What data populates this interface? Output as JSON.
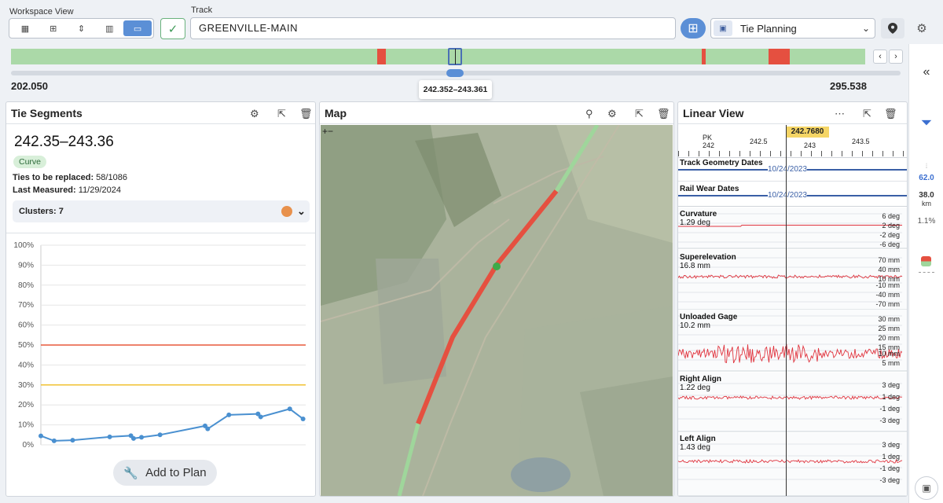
{
  "header": {
    "workspace_label": "Workspace View",
    "track_label": "Track",
    "track_value": "GREENVILLE-MAIN",
    "plan_value": "Tie Planning",
    "view_buttons": [
      {
        "icon": "table-icon",
        "active": false
      },
      {
        "icon": "grid-icon",
        "active": false
      },
      {
        "icon": "sort-icon",
        "active": false
      },
      {
        "icon": "map-icon",
        "active": false
      },
      {
        "icon": "window-icon",
        "active": true
      }
    ]
  },
  "range": {
    "start": "202.050",
    "end": "295.538",
    "tooltip": "242.352–243.361",
    "selected_fraction": [
      0.4283,
      0.4391
    ],
    "red_segments": [
      [
        0.4283,
        0.4391
      ],
      [
        0.8091,
        0.8135
      ],
      [
        0.8866,
        0.9114
      ]
    ]
  },
  "tie_segments": {
    "title": "Tie Segments",
    "range_title": "242.35–243.36",
    "chip": "Curve",
    "ties_label": "Ties to be replaced:",
    "ties_value": "58/1086",
    "measured_label": "Last Measured:",
    "measured_value": "11/29/2024",
    "clusters_label": "Clusters: 7",
    "cluster_color": "#e8914c",
    "add_button": "Add to Plan"
  },
  "chart_data": {
    "type": "line",
    "ylim": [
      0,
      100
    ],
    "yticks": [
      "100%",
      "90%",
      "80%",
      "70%",
      "60%",
      "50%",
      "40%",
      "30%",
      "20%",
      "10%",
      "0%"
    ],
    "thresholds": [
      {
        "value": 50,
        "color": "#e8593b"
      },
      {
        "value": 30,
        "color": "#f1c232"
      }
    ],
    "series": [
      {
        "values": [
          [
            0,
            4.5
          ],
          [
            0.05,
            2
          ],
          [
            0.12,
            2.3
          ],
          [
            0.26,
            4
          ],
          [
            0.34,
            4.6
          ],
          [
            0.35,
            3.2
          ],
          [
            0.38,
            3.8
          ],
          [
            0.45,
            5
          ],
          [
            0.62,
            9.5
          ],
          [
            0.63,
            8
          ],
          [
            0.71,
            15
          ],
          [
            0.82,
            15.5
          ],
          [
            0.83,
            14
          ],
          [
            0.94,
            18
          ],
          [
            0.99,
            13
          ]
        ]
      }
    ]
  },
  "map": {
    "title": "Map",
    "zoom_label": "+−"
  },
  "linear": {
    "title": "Linear View",
    "cursor_value": "242.7680",
    "pk_label": "PK",
    "ticks": [
      "242",
      "242.5",
      "243",
      "243.5"
    ],
    "sections": [
      {
        "name": "Track Geometry Dates",
        "date": "10/24/2023"
      },
      {
        "name": "Rail Wear Dates",
        "date": "10/24/2023"
      }
    ],
    "curvature": {
      "name": "Curvature",
      "value": "1.29 deg",
      "ticks": [
        "6 deg",
        "2 deg",
        "-2 deg",
        "-6 deg"
      ]
    },
    "superelevation": {
      "name": "Superelevation",
      "value": "16.8 mm",
      "ticks": [
        "70 mm",
        "40 mm",
        "10 mm",
        "-10 mm",
        "-40 mm",
        "-70 mm"
      ]
    },
    "gage": {
      "name": "Unloaded Gage",
      "value": "10.2 mm",
      "ticks": [
        "30 mm",
        "25 mm",
        "20 mm",
        "15 mm",
        "10 mm",
        "5 mm"
      ]
    },
    "right_align": {
      "name": "Right Align",
      "value": "1.22 deg",
      "ticks": [
        "3 deg",
        "1 deg",
        "-1 deg",
        "-3 deg"
      ]
    },
    "left_align": {
      "name": "Left Align",
      "value": "1.43 deg",
      "ticks": [
        "3 deg",
        "1 deg",
        "-1 deg",
        "-3 deg"
      ]
    }
  },
  "sidebar": {
    "value1": "62.0",
    "value2": "38.0",
    "unit2": "km",
    "value3": "1.1%"
  }
}
